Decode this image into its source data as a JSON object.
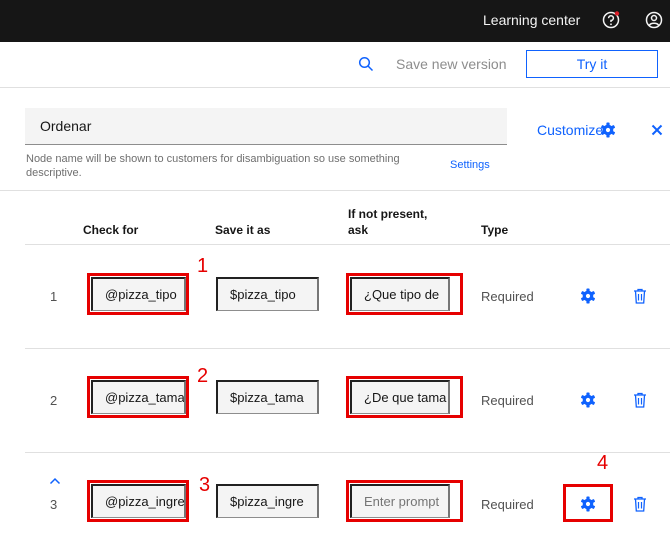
{
  "header": {
    "learning_center": "Learning center",
    "help_icon": "help-icon",
    "user_icon": "user-icon"
  },
  "toolbar": {
    "search_icon": "search-icon",
    "save_new_version": "Save new version",
    "try_it": "Try it"
  },
  "node": {
    "name_value": "Ordenar",
    "customize": "Customize",
    "helper_text": "Node name will be shown to customers for disambiguation so use something descriptive.",
    "settings": "Settings"
  },
  "table": {
    "headers": {
      "check_for": "Check for",
      "save_it_as": "Save it as",
      "if_not_present": "If not present,",
      "ask": "ask",
      "type": "Type"
    },
    "rows": [
      {
        "num": "1",
        "check_for": "@pizza_tipo",
        "save_as": "$pizza_tipo",
        "prompt": "¿Que tipo de",
        "prompt_placeholder": "",
        "type": "Required"
      },
      {
        "num": "2",
        "check_for": "@pizza_tama",
        "save_as": "$pizza_tama",
        "prompt": "¿De que tama",
        "prompt_placeholder": "",
        "type": "Required"
      },
      {
        "num": "3",
        "check_for": "@pizza_ingre",
        "save_as": "$pizza_ingre",
        "prompt": "",
        "prompt_placeholder": "Enter prompt",
        "type": "Required"
      }
    ]
  },
  "annotations": [
    "1",
    "2",
    "3",
    "4"
  ],
  "colors": {
    "accent": "#0f62fe",
    "topbar": "#161616",
    "annotation_red": "#e60000"
  }
}
